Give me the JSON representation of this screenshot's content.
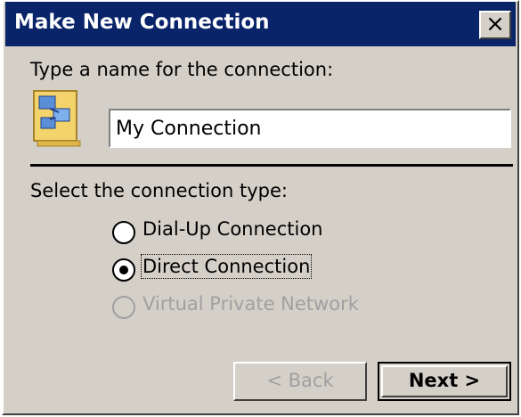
{
  "window": {
    "title": "Make New Connection",
    "close_label": "×"
  },
  "name_section": {
    "prompt": "Type a name for the connection:",
    "icon": "network-connection-icon",
    "input_value": "My Connection"
  },
  "type_section": {
    "prompt": "Select the connection type:",
    "options": [
      {
        "label": "Dial-Up Connection",
        "selected": false,
        "enabled": true
      },
      {
        "label": "Direct Connection",
        "selected": true,
        "enabled": true
      },
      {
        "label": "Virtual Private Network",
        "selected": false,
        "enabled": false
      }
    ]
  },
  "buttons": {
    "back_label": "< Back",
    "next_label": "Next >"
  },
  "colors": {
    "titlebar": "#0a246a",
    "face": "#d4d0c8",
    "disabled_text": "#a0a0a0"
  }
}
